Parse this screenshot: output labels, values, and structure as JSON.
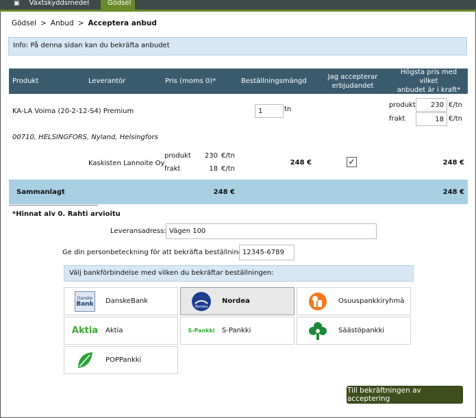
{
  "tabs": [
    {
      "label": "Växtskyddsmedel"
    },
    {
      "label": "Gödsel"
    }
  ],
  "breadcrumb": {
    "items": [
      "Gödsel",
      "Anbud"
    ],
    "current": "Acceptera anbud",
    "sep": ">"
  },
  "info": "Info: På denna sidan kan du bekräfta anbudet",
  "table": {
    "headers": {
      "product": "Produkt",
      "supplier": "Leverantör",
      "price": "Pris (moms 0)*",
      "qty": "Beställningsmängd",
      "accept_1": "Jag accepterar",
      "accept_2": "erbjudandet",
      "max_1": "Högsta pris med vilket",
      "max_2": "anbudet är i kraft*"
    },
    "product_name": "KA-LA Voima (20-2-12-S4) Premium",
    "qty_value": "1",
    "qty_unit": "tn",
    "max_product_label": "produkt",
    "max_product_value": "230",
    "max_freight_label": "frakt",
    "max_freight_value": "18",
    "max_unit": "€/tn",
    "address_line": "00710, HELSINGFORS, Nyland, Helsingfors",
    "offer": {
      "supplier": "Kaskisten Lannoite Oy",
      "product_label": "produkt",
      "product_price": "230",
      "freight_label": "frakt",
      "freight_price": "18",
      "unit": "€/tn",
      "total": "248 €",
      "accepted": true,
      "max_total": "248 €"
    },
    "sum_label": "Sammanlagt",
    "sum_price": "248 €",
    "sum_max": "248 €"
  },
  "note": "*Hinnat alv 0. Rahti arvioitu",
  "delivery": {
    "label": "Leveransadress:",
    "value": "Vägen 100"
  },
  "ssn": {
    "label": "Ge din personbeteckning för att bekräfta beställningen",
    "value": "12345-6789"
  },
  "bank_prompt": "Välj bankförbindelse med vilken du bekräftar beställningen:",
  "banks": [
    {
      "name": "DanskeBank",
      "logo_text": "Danske",
      "logo_sub": "Bank"
    },
    {
      "name": "Nordea",
      "logo_text": "Nordea"
    },
    {
      "name": "Osuuspankkiryhmä"
    },
    {
      "name": "Aktia",
      "logo_text": "Aktia"
    },
    {
      "name": "S-Pankki",
      "logo_text": "S-Pankki"
    },
    {
      "name": "Säästöpankki"
    },
    {
      "name": "POPPankki"
    }
  ],
  "selected_bank": "Nordea",
  "submit": "Till bekräftningen av acceptering",
  "colors": {
    "header": "#3a5b6d",
    "accent_green": "#6a8a2a",
    "button": "#3e4f1d",
    "sum_row": "#a9cfe3",
    "info_bg": "#d7e7f3"
  }
}
